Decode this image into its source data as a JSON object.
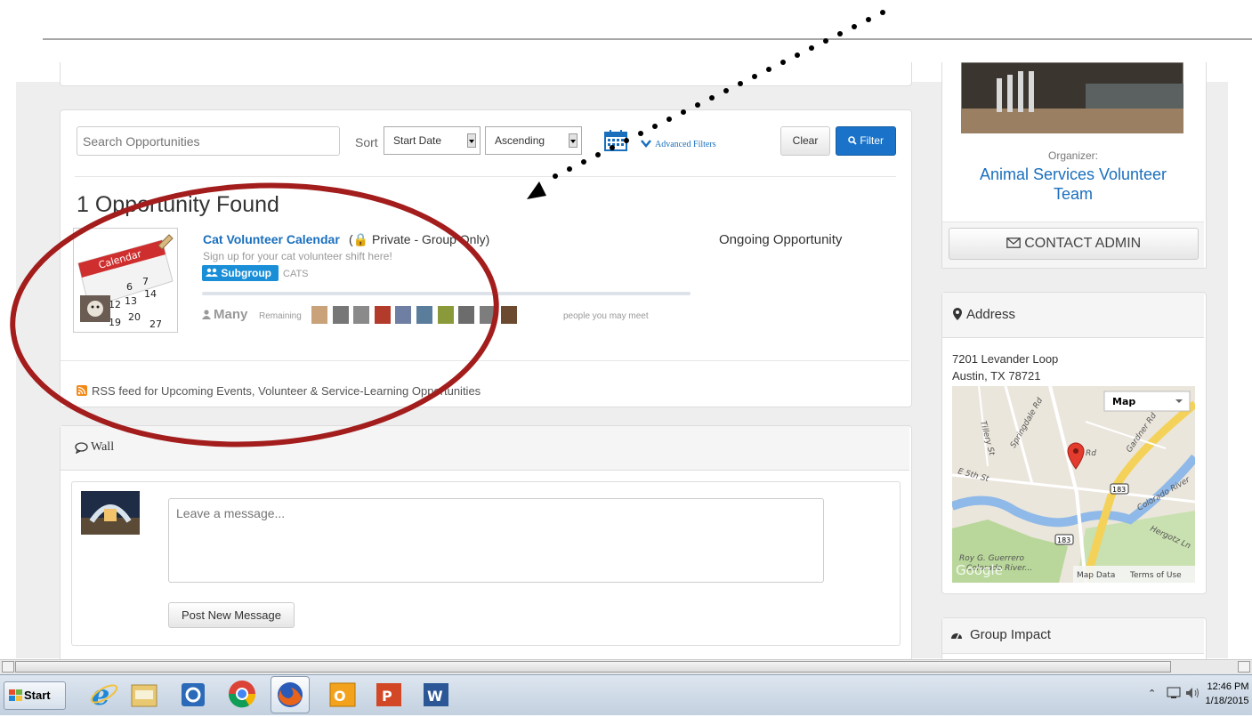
{
  "search": {
    "placeholder": "Search Opportunities"
  },
  "sort": {
    "label": "Sort",
    "field": "Start Date",
    "order": "Ascending"
  },
  "advanced_filters": "Advanced Filters",
  "buttons": {
    "clear": "Clear",
    "filter": "Filter"
  },
  "results": {
    "heading": "1 Opportunity Found",
    "item": {
      "title": "Cat Volunteer Calendar",
      "privacy": "(🔒 Private - Group Only)",
      "description": "Sign up for your cat volunteer shift here!",
      "badge": "Subgroup",
      "tag": "CATS",
      "status": "Ongoing Opportunity",
      "remaining_count": "Many",
      "remaining_label": "Remaining",
      "people_text": "people you may meet",
      "calendar_word": "Calendar"
    }
  },
  "rss": "RSS feed for Upcoming Events, Volunteer & Service-Learning Opportunities",
  "wall": {
    "title": "Wall",
    "placeholder": "Leave a message...",
    "post_button": "Post New Message"
  },
  "sidebar": {
    "organizer_label": "Organizer:",
    "organizer_name": "Animal Services Volunteer Team",
    "contact_button": "CONTACT ADMIN",
    "address_title": "Address",
    "address_line1": "7201 Levander Loop",
    "address_line2": "Austin, TX 78721",
    "map_type": "Map",
    "map_data": "Map Data",
    "terms": "Terms of Use",
    "google": "Google",
    "map_labels": {
      "tillery": "Tillery St",
      "springdale": "Springdale Rd",
      "gardner": "Gardner Rd",
      "e5th": "E 5th St",
      "rd": "Rd",
      "hwy": "183",
      "hwy2": "183",
      "colorado": "Colorado River",
      "hergotz": "Hergotz Ln",
      "roy": "Roy G. Guerrero",
      "river": "Colorado River..."
    },
    "impact_title": "Group Impact"
  },
  "taskbar": {
    "start": "Start",
    "time": "12:46 PM",
    "date": "1/18/2015"
  },
  "annotation": {
    "color": "#a31d1d"
  }
}
